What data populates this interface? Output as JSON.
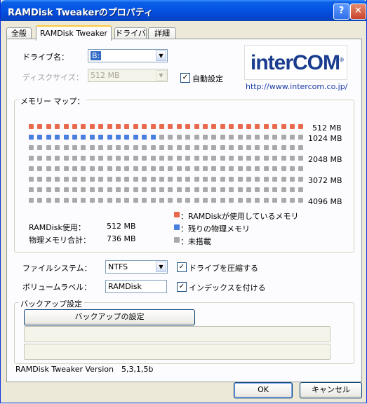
{
  "window": {
    "title": "RAMDisk Tweakerのプロパティ",
    "help_glyph": "?",
    "close_glyph": "✕"
  },
  "tabs": [
    {
      "label": "全般"
    },
    {
      "label": "RAMDisk Tweaker"
    },
    {
      "label": "ドライバ"
    },
    {
      "label": "詳細"
    }
  ],
  "drive": {
    "label": "ドライブ名：",
    "value": "B:"
  },
  "disk_size": {
    "label": "ディスクサイズ：",
    "value": "512 MB"
  },
  "auto_setting": {
    "label": "自動設定",
    "checked": true
  },
  "logo": {
    "text": "interCOM",
    "registered": "®",
    "url": "http://www.intercom.co.jp/"
  },
  "memory_map": {
    "title": "メモリー マップ：",
    "row_labels": [
      "512 MB",
      "1024 MB",
      "2048 MB",
      "3072 MB",
      "4096 MB"
    ],
    "rows": 8,
    "columns": 32,
    "used_cells": 32,
    "remaining_cells": 15,
    "total_cells": 256,
    "colors": {
      "used": "#E9694E",
      "remaining": "#4A7FE0",
      "unmounted": "#A9A9A9"
    },
    "stats": [
      {
        "label": "RAMDisk使用：",
        "value": "512 MB"
      },
      {
        "label": "物理メモリ合計：",
        "value": "736 MB"
      }
    ],
    "legend": [
      {
        "key": "used",
        "label": "：RAMDiskが使用しているメモリ"
      },
      {
        "key": "remaining",
        "label": "：残りの物理メモリ"
      },
      {
        "key": "unmounted",
        "label": "：未搭載"
      }
    ]
  },
  "filesystem": {
    "label": "ファイルシステム：",
    "value": "NTFS"
  },
  "compress": {
    "label": "ドライブを圧縮する",
    "checked": true
  },
  "volume_label": {
    "label": "ボリュームラベル：",
    "value": "RAMDisk"
  },
  "index": {
    "label": "インデックスを付ける",
    "checked": true
  },
  "backup": {
    "title": "バックアップ設定",
    "button": "バックアップの設定"
  },
  "version": {
    "label": "RAMDisk Tweaker Version",
    "value": "5,3,1,5b"
  },
  "footer": {
    "ok": "OK",
    "cancel": "キャンセル"
  }
}
